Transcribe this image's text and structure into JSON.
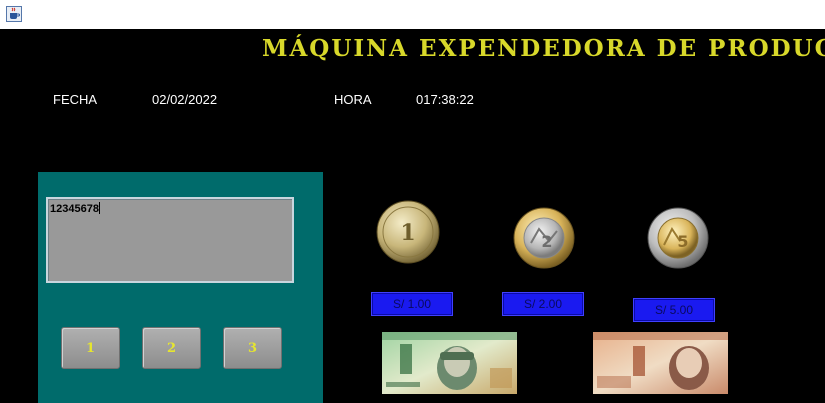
{
  "window": {
    "icon": "java-cup-icon"
  },
  "header": {
    "title": "MÁQUINA EXPENDEDORA DE PRODUC",
    "date_label": "FECHA",
    "date_value": "02/02/2022",
    "time_label": "HORA",
    "time_value": "017:38:22"
  },
  "keypad": {
    "display_value": "12345678",
    "keys": [
      "1",
      "2",
      "3"
    ]
  },
  "coins": [
    {
      "label": "S/ 1.00",
      "icon": "coin-1-sol-icon"
    },
    {
      "label": "S/ 2.00",
      "icon": "coin-2-soles-icon"
    },
    {
      "label": "S/ 5.00",
      "icon": "coin-5-soles-icon"
    }
  ],
  "bills": [
    {
      "icon": "bill-10-soles-icon"
    },
    {
      "icon": "bill-20-soles-icon"
    }
  ],
  "colors": {
    "title": "#d8d82a",
    "panel": "#006b6b",
    "coin_button": "#1a1af0"
  }
}
